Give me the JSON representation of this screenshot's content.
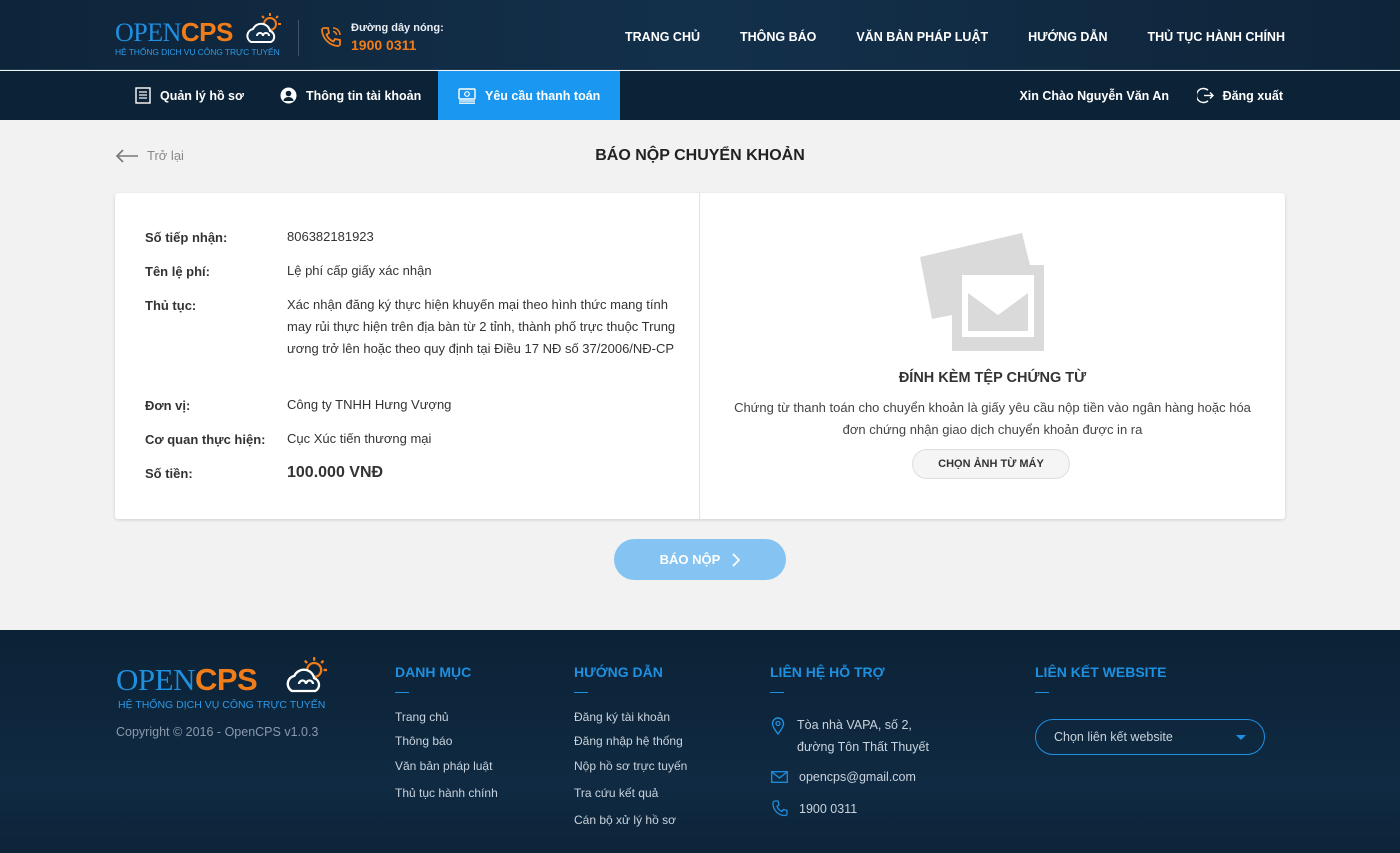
{
  "header": {
    "logo_open": "OPEN",
    "logo_cps": "CPS",
    "logo_tagline": "HỆ THỐNG DỊCH VỤ CÔNG TRỰC TUYẾN",
    "hotline_label": "Đường dây nóng:",
    "hotline_number": "1900 0311",
    "nav": [
      "TRANG CHỦ",
      "THÔNG BÁO",
      "VĂN BẢN PHÁP LUẬT",
      "HƯỚNG DẪN",
      "THỦ TỤC HÀNH CHÍNH"
    ]
  },
  "subnav": {
    "items": [
      {
        "label": "Quản lý hồ sơ",
        "icon": "document-icon"
      },
      {
        "label": "Thông tin tài khoản",
        "icon": "user-icon"
      },
      {
        "label": "Yêu cầu thanh toán",
        "icon": "payment-icon",
        "active": true
      }
    ],
    "greeting": "Xin Chào Nguyễn Văn An",
    "logout": "Đăng xuất"
  },
  "page": {
    "back_label": "Trở lại",
    "title": "BÁO NỘP CHUYỂN KHOẢN"
  },
  "details": {
    "receipt_label": "Số tiếp nhận:",
    "receipt_value": "806382181923",
    "fee_label": "Tên lệ phí:",
    "fee_value": "Lệ phí cấp giấy xác nhận",
    "procedure_label": "Thủ tục:",
    "procedure_value": "Xác nhận đăng ký thực hiện khuyến mại theo hình thức mang tính may rủi thực hiện trên địa bàn từ 2 tỉnh, thành phố trực thuộc Trung ương trở lên hoặc theo quy định tại Điều 17 NĐ số 37/2006/NĐ-CP",
    "unit_label": "Đơn vị:",
    "unit_value": "Công ty TNHH Hưng Vượng",
    "agency_label": "Cơ quan thực hiện:",
    "agency_value": "Cục Xúc tiến thương mại",
    "amount_label": "Số tiền:",
    "amount_value": "100.000 VNĐ"
  },
  "attachment": {
    "title": "ĐÍNH KÈM TỆP CHỨNG TỪ",
    "description": "Chứng từ thanh toán cho chuyển khoản là giấy yêu cầu nộp tiền vào ngân hàng hoặc hóa đơn chứng nhận giao dịch chuyển khoản được in ra",
    "button": "CHỌN ẢNH TỪ MÁY"
  },
  "submit_label": "BÁO NỘP",
  "footer": {
    "logo_open": "OPEN",
    "logo_cps": "CPS",
    "logo_tagline": "HỆ THỐNG DỊCH VỤ CÔNG TRỰC TUYẾN",
    "copyright": "Copyright © 2016 - OpenCPS v1.0.3",
    "menu_title": "DANH MỤC",
    "menu_links": [
      "Trang chủ",
      "Thông báo",
      "Văn bản pháp luật",
      "Thủ tục hành chính"
    ],
    "guide_title": "HƯỚNG DẪN",
    "guide_links": [
      "Đăng ký tài khoản",
      "Đăng nhập hệ thống",
      "Nộp hồ sơ trực tuyến",
      "Tra cứu kết quả",
      "Cán bộ xử lý hồ sơ"
    ],
    "contact_title": "LIÊN HỆ HỖ TRỢ",
    "address_line1": "Tòa nhà VAPA, số 2,",
    "address_line2": "đường Tôn Thất Thuyết",
    "email": "opencps@gmail.com",
    "phone": "1900 0311",
    "links_title": "LIÊN KẾT WEBSITE",
    "select_placeholder": "Chọn liên kết website"
  },
  "colors": {
    "accent": "#1a97f0",
    "brand_orange": "#f07d1a",
    "header_bg": "#0e2439",
    "submit_disabled": "#85c4f2"
  }
}
